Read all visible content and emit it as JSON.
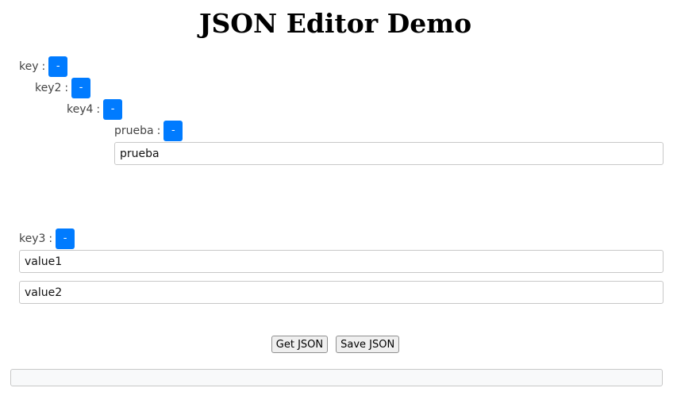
{
  "page": {
    "title": "JSON Editor Demo"
  },
  "editor": {
    "separator": ":",
    "remove_label": "-",
    "key": {
      "label": "key"
    },
    "key2": {
      "label": "key2"
    },
    "key4": {
      "label": "key4"
    },
    "prueba": {
      "label": "prueba",
      "value": "prueba"
    },
    "key3": {
      "label": "key3",
      "values": [
        "value1",
        "value2"
      ]
    }
  },
  "actions": {
    "get_json_label": "Get JSON",
    "save_json_label": "Save JSON"
  },
  "output": {
    "text": ""
  },
  "colors": {
    "remove_button_bg": "#007bff"
  }
}
